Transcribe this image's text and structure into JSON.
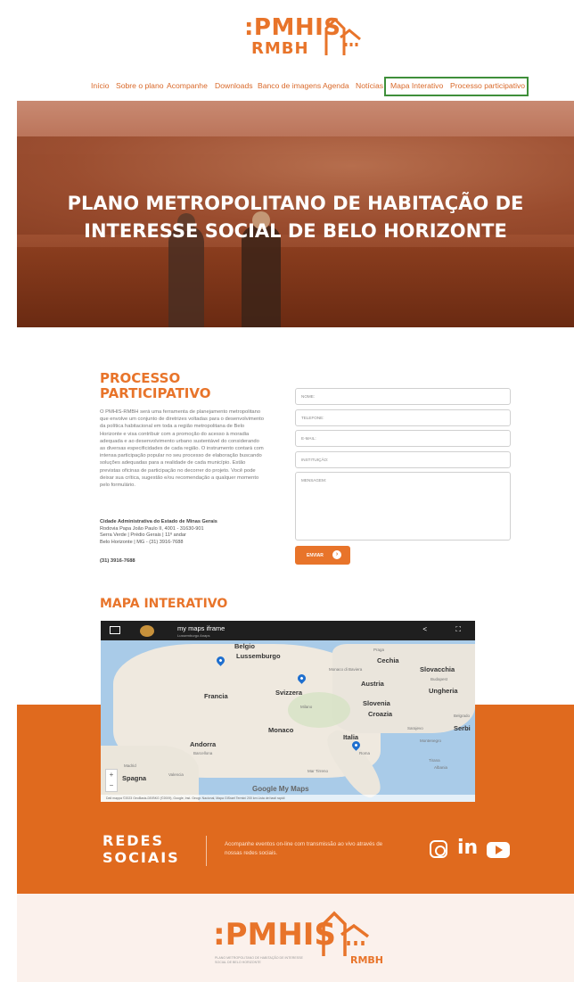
{
  "logo": {
    "line1": ":PMHIS",
    "line2": "RMBH"
  },
  "nav": {
    "items": [
      "Início",
      "Sobre o plano",
      "Acompanhe",
      "Downloads",
      "Banco de imagens",
      "Agenda",
      "Notícias",
      "Mapa Interativo",
      "Processo participativo"
    ]
  },
  "hero": {
    "title_line1": "PLANO METROPOLITANO DE HABITAÇÃO DE",
    "title_line2": "INTERESSE SOCIAL DE BELO HORIZONTE"
  },
  "participativo": {
    "title_line1": "PROCESSO",
    "title_line2": "PARTICIPATIVO",
    "text": "O PMHIS-RMBH será uma ferramenta de planejamento metropolitano que envolve um conjunto de diretrizes voltadas para o desenvolvimento da política habitacional em toda a região metropolitana de Belo Horizonte e visa contribuir com a promoção do acesso à moradia adequada e ao desenvolvimento urbano sustentável do considerando as diversas especificidades de cada região. O instrumento contará com intensa participação popular no seu processo de elaboração buscando soluções adequadas para a realidade de cada município. Estão previstas oficinas de participação no decorrer do projeto. Você pode deixar sua crítica, sugestão e/ou recomendação a qualquer momento pelo formulário.",
    "addr_title": "Cidade Administrativa do Estado de Minas Gerais",
    "addr_line1": "Rodovia Papa João Paulo II, 4001 - 31630-901",
    "addr_line2": "Serra Verde | Prédio Gerais | 11º andar",
    "addr_line3": "Belo Horizonte | MG - (31) 3916-7688",
    "phone": "(31) 3916-7688"
  },
  "form": {
    "nome": "NOME:",
    "telefone": "TELEFONE:",
    "email": "E-MAIL:",
    "instituicao": "INSTITUIÇÃO:",
    "mensagem": "MENSAGEM:",
    "send": "ENVIAR"
  },
  "mapa": {
    "title": "MAPA INTERATIVO",
    "iframe_title": "my maps iframe",
    "iframe_sub": "Lussemburgo Anaps",
    "labels": {
      "belgio": "Belgio",
      "lussemburgo": "Lussemburgo",
      "praga": "Praga",
      "cechia": "Cechia",
      "slovacchia": "Slovacchia",
      "monaco_baviera": "Monaco di Baviera",
      "austria": "Austria",
      "budapest": "Budapest",
      "ungheria": "Ungheria",
      "francia": "Francia",
      "svizzera": "Svizzera",
      "milano": "Milano",
      "slovenia": "Slovenia",
      "croazia": "Croazia",
      "monaco": "Monaco",
      "italia": "Italia",
      "roma": "Roma",
      "andorra": "Andorra",
      "barcellona": "Barcellona",
      "madrid": "Madrid",
      "valencia": "Valencia",
      "spagna": "Spagna",
      "serbi": "Serbi",
      "sarajevo": "Sarajevo",
      "montenegro": "Montenegro",
      "tirana": "Tirana",
      "albania": "Albania",
      "belgrado": "Belgrado",
      "mar_tirreno": "Mar Tirreno",
      "google": "Google My Maps",
      "footer": "Dati mappa ©2023 GeoBasis-DE/BKG (©2009), Google, Inst. Geogr. Nacional, Mapa GISrael  Termini  200 km  Lista dei tasti rapidi"
    }
  },
  "redes": {
    "title_line1": "REDES",
    "title_line2": "SOCIAIS",
    "text": "Acompanhe eventos on-line com transmissão ao vivo através de nossas redes sociais."
  },
  "footer": {
    "logo_line1": ":PMHIS",
    "logo_line2": "RMBH",
    "subtitle": "PLANO METROPOLITANO DE HABITAÇÃO DE INTERESSE SOCIAL DE BELO HORIZONTE"
  },
  "colors": {
    "accent": "#e8742a",
    "band": "#e06a1e",
    "highlight_box": "#3f8f3a"
  }
}
